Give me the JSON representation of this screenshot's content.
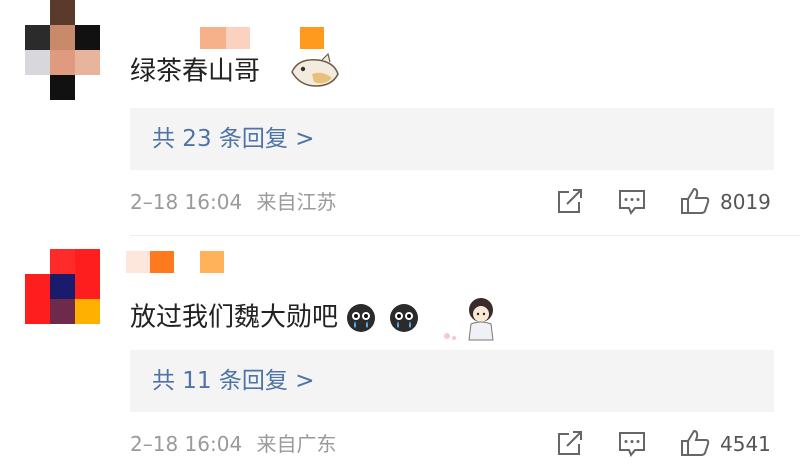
{
  "comments": [
    {
      "text": "绿茶春山哥",
      "replies_label": "共 23 条回复 >",
      "date": "2–18 16:04",
      "location": "来自江苏",
      "likes": "8019",
      "avatar_colors": [
        "#c98a6c",
        "#2a1a12",
        "#d9d9d9"
      ]
    },
    {
      "text": "放过我们魏大勋吧",
      "replies_label": "共 11 条回复 >",
      "date": "2–18 16:04",
      "location": "来自广东",
      "likes": "4541",
      "avatar_colors": [
        "#ff1e1e",
        "#1b1b6e",
        "#ffb000"
      ]
    }
  ],
  "icons": {
    "share": "share-icon",
    "comment": "comment-icon",
    "like": "thumbs-up-icon"
  },
  "colors": {
    "link_blue": "#4e73a6",
    "meta_gray": "#9a9a9a",
    "reply_bg": "#f4f4f4"
  }
}
